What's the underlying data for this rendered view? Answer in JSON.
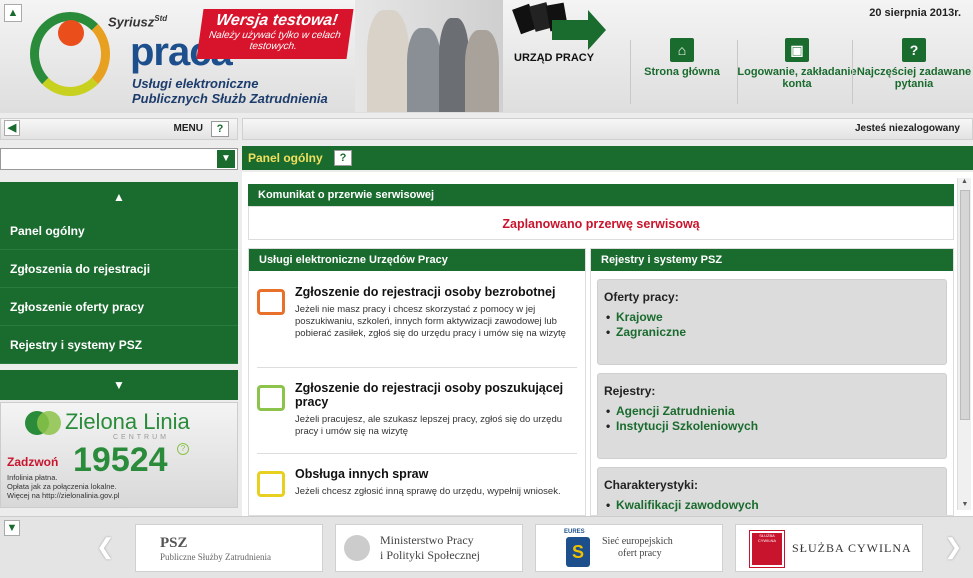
{
  "header": {
    "brand_small": "Syriusz",
    "brand_sup": "Std",
    "brand_big": "praca",
    "brand_sub": "Usługi elektroniczne\nPublicznych Służb Zatrudnienia",
    "banner_title": "Wersja testowa!",
    "banner_text": "Należy używać tylko w celach testowych.",
    "urzad_label": "URZĄD PRACY",
    "date": "20 sierpnia 2013r.",
    "nav": [
      {
        "label": "Strona główna",
        "icon": "home-icon",
        "glyph": "⌂"
      },
      {
        "label": "Logowanie, zakładanie konta",
        "icon": "lock-icon",
        "glyph": "🔒"
      },
      {
        "label": "Najczęściej zadawane pytania",
        "icon": "question-icon",
        "glyph": "?"
      }
    ]
  },
  "menu_bar": {
    "menu_label": "MENU",
    "help": "?",
    "login_status": "Jesteś niezalogowany"
  },
  "sidebar": {
    "search_value": "",
    "items": [
      "Panel ogólny",
      "Zgłoszenia do rejestracji",
      "Zgłoszenie oferty pracy",
      "Rejestry i systemy PSZ"
    ],
    "green_line": {
      "name": "Zielona Linia",
      "sub": "CENTRUM",
      "call": "Zadzwoń",
      "number": "19524",
      "info": "Infolinia płatna.\nOpłata jak za połączenia lokalne.\nWięcej na http://zielonalinia.gov.pl"
    }
  },
  "main": {
    "title": "Panel ogólny",
    "help": "?",
    "notice": {
      "title": "Komunikat o przerwie serwisowej",
      "text": "Zaplanowano przerwę serwisową"
    },
    "services": {
      "title": "Usługi elektroniczne Urzędów Pracy",
      "items": [
        {
          "title": "Zgłoszenie do rejestracji osoby bezrobotnej",
          "desc": "Jeżeli nie masz pracy i chcesz skorzystać z pomocy w jej poszukiwaniu, szkoleń, innych form aktywizacji zawodowej lub pobierać zasiłek, zgłoś się do urzędu pracy i umów się na wizytę",
          "color": "#e8702a"
        },
        {
          "title": "Zgłoszenie do rejestracji osoby poszukującej pracy",
          "desc": "Jeżeli pracujesz, ale szukasz lepszej pracy, zgłoś się do urzędu pracy i umów się na wizytę",
          "color": "#8cc34a"
        },
        {
          "title": "Obsługa innych spraw",
          "desc": "Jeżeli chcesz zgłosić inną sprawę do urzędu, wypełnij wniosek.",
          "color": "#e8d020"
        }
      ]
    },
    "registries": {
      "title": "Rejestry i systemy PSZ",
      "groups": [
        {
          "title": "Oferty pracy:",
          "links": [
            "Krajowe",
            "Zagraniczne"
          ]
        },
        {
          "title": "Rejestry:",
          "links": [
            "Agencji Zatrudnienia",
            "Instytucji Szkoleniowych"
          ]
        },
        {
          "title": "Charakterystyki:",
          "links": [
            "Kwalifikacji zawodowych"
          ]
        }
      ]
    }
  },
  "footer": {
    "logos": [
      {
        "title": "PSZ",
        "sub": "Publiczne Służby Zatrudnienia"
      },
      {
        "title": "Ministerstwo Pracy",
        "sub": "i Polityki Społecznej"
      },
      {
        "badge": "EURES",
        "title": "Sieć europejskich",
        "sub": "ofert pracy"
      },
      {
        "badge": "SŁUŻBA CYWILNA",
        "title": "SŁUŻBA CYWILNA",
        "sub": ""
      }
    ]
  },
  "colors": {
    "primary_green": "#1a6b2e",
    "alert_red": "#d8142c",
    "link_green": "#1a6b2e"
  }
}
